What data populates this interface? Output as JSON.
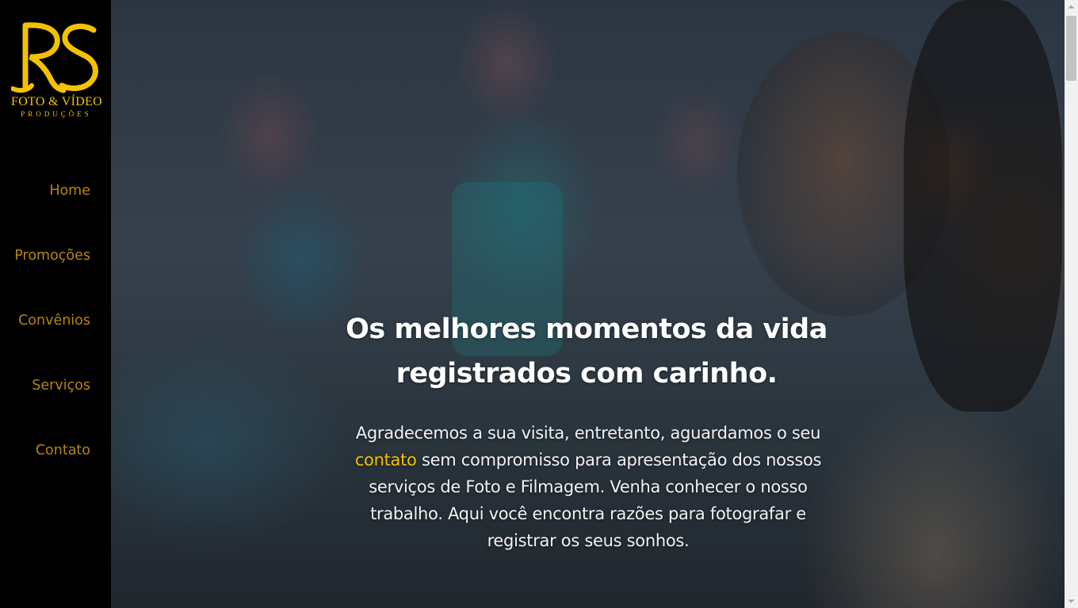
{
  "brand": {
    "mark": "RS",
    "line1": "FOTO & VÍDEO",
    "line2": "PRODUÇÕES"
  },
  "nav": [
    {
      "label": "Home"
    },
    {
      "label": "Promoções"
    },
    {
      "label": "Convênios"
    },
    {
      "label": "Serviços"
    },
    {
      "label": "Contato"
    }
  ],
  "hero": {
    "headline_line1": "Os melhores momentos da vida",
    "headline_line2": "registrados com carinho.",
    "paragraph_before": "Agradecemos a sua visita, entretanto, aguardamos o seu ",
    "paragraph_link": "contato",
    "paragraph_after": " sem compromisso para apresentação dos nossos serviços de Foto e Filmagem. Venha conhecer o nosso trabalho. Aqui você encontra razões para fotografar e registrar os seus sonhos."
  },
  "colors": {
    "sidebar_bg": "#000000",
    "brand_gold": "#f2c200",
    "nav_text": "#b5860f",
    "hero_text": "#ffffff"
  }
}
